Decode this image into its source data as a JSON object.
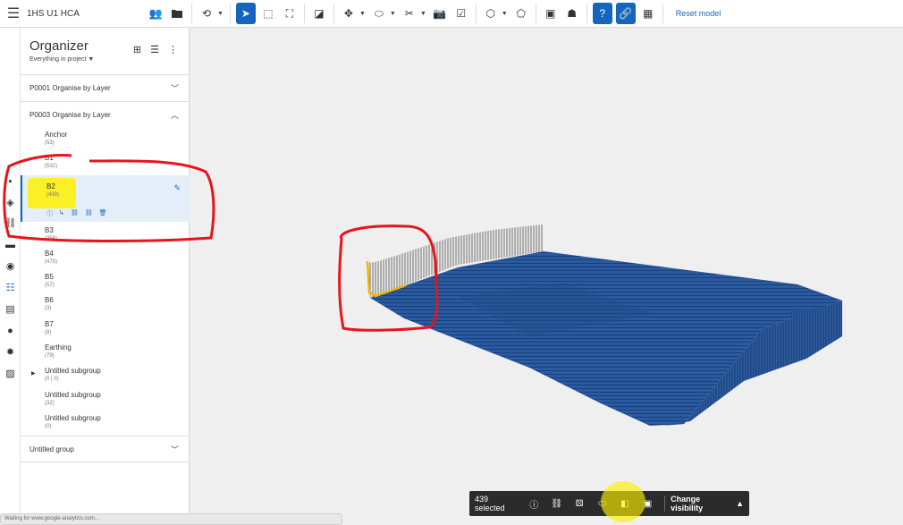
{
  "header": {
    "project_title": "1HS U1 HCA",
    "reset_label": "Reset model",
    "icons": [
      "menu-icon",
      "add-user-icon",
      "folder-icon",
      "orbit-icon",
      "cursor-icon",
      "box-select-icon",
      "crop-icon",
      "measure-icon",
      "axis-icon",
      "ellipse-icon",
      "scissors-icon",
      "camera-icon",
      "task-icon",
      "cube-icon",
      "shield-icon",
      "gallery-icon",
      "ghost-icon",
      "help-icon",
      "link-icon",
      "calculator-icon"
    ]
  },
  "organizer": {
    "title": "Organizer",
    "subtitle": "Everything in project",
    "sections": [
      {
        "label": "P0001 Organise by Layer",
        "expanded": false
      },
      {
        "label": "P0003 Organise by Layer",
        "expanded": true
      },
      {
        "label": "Untitled group",
        "expanded": false
      }
    ],
    "items": [
      {
        "name": "Anchor",
        "count": "(53)"
      },
      {
        "name": "B1",
        "count": "(532)"
      },
      {
        "name": "B2",
        "count": "(439)"
      },
      {
        "name": "B3",
        "count": "(356)"
      },
      {
        "name": "B4",
        "count": "(475)"
      },
      {
        "name": "B5",
        "count": "(57)"
      },
      {
        "name": "B6",
        "count": "(3)"
      },
      {
        "name": "B7",
        "count": "(8)"
      },
      {
        "name": "Earthing",
        "count": "(79)"
      },
      {
        "name": "Untitled subgroup",
        "count": "(0 | 0)"
      },
      {
        "name": "Untitled subgroup",
        "count": "(32)"
      },
      {
        "name": "Untitled subgroup",
        "count": "(0)"
      }
    ]
  },
  "selection_bar": {
    "count_label": "439 selected",
    "change_visibility": "Change visibility"
  },
  "status": {
    "text": "Waiting for www.google-analytics.com..."
  },
  "colors": {
    "accent": "#1565c0",
    "model_blue": "#1d4b8f",
    "annotation_red": "#e8141b",
    "highlight_yellow": "#fff200",
    "edge_orange": "#f4b400"
  }
}
